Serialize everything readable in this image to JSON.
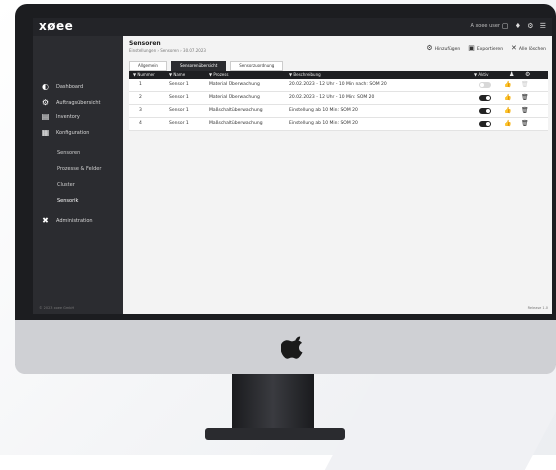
{
  "app": {
    "logo": "xøee",
    "user": "A xoee user",
    "top_icons": "▢ ♦ ⚙ ☰"
  },
  "sidebar": {
    "items": [
      {
        "label": "Dashboard",
        "icon": "dashboard-icon"
      },
      {
        "label": "Auftragsübersicht",
        "icon": "order-overview-icon"
      },
      {
        "label": "Inventory",
        "icon": "inventory-icon"
      },
      {
        "label": "Konfiguration",
        "icon": "configuration-icon"
      }
    ],
    "subitems": [
      "Sensoren",
      "Prozesse & Felder",
      "Cluster",
      "Sensorik"
    ],
    "admin": {
      "label": "Administration",
      "icon": "tools-icon"
    },
    "footer": "© 2023 xoee GmbH",
    "version": "Release 1.0"
  },
  "main": {
    "title": "Sensoren",
    "breadcrumb": "Einstellungen › Sensoren › 30.07.2023",
    "actions": [
      "Hinzufügen",
      "Exportieren",
      "Alle löschen"
    ],
    "tabs": [
      "Allgemein",
      "Sensorenübersicht",
      "Sensorzuordnung"
    ],
    "table": {
      "headers": [
        "Nummer",
        "Name",
        "Prozess",
        "Beschreibung",
        "Aktiv"
      ],
      "rows": [
        {
          "num": "1",
          "name": "Sensor 1",
          "proc": "Material Überwachung",
          "desc": "20.02.2023 - 12 Uhr - 10 Min nach: SOM 20",
          "active": false
        },
        {
          "num": "2",
          "name": "Sensor 1",
          "proc": "Material Überwachung",
          "desc": "20.02.2023 - 12 Uhr - 10 Min: SOM 20",
          "active": true
        },
        {
          "num": "3",
          "name": "Sensor 1",
          "proc": "Maßschaltüberwachung",
          "desc": "Einstellung ab 10 Min: SOM 20",
          "active": true
        },
        {
          "num": "4",
          "name": "Sensor 1",
          "proc": "Maßschaltüberwachung",
          "desc": "Einstellung ab 10 Min: SOM 20",
          "active": true
        }
      ]
    }
  }
}
